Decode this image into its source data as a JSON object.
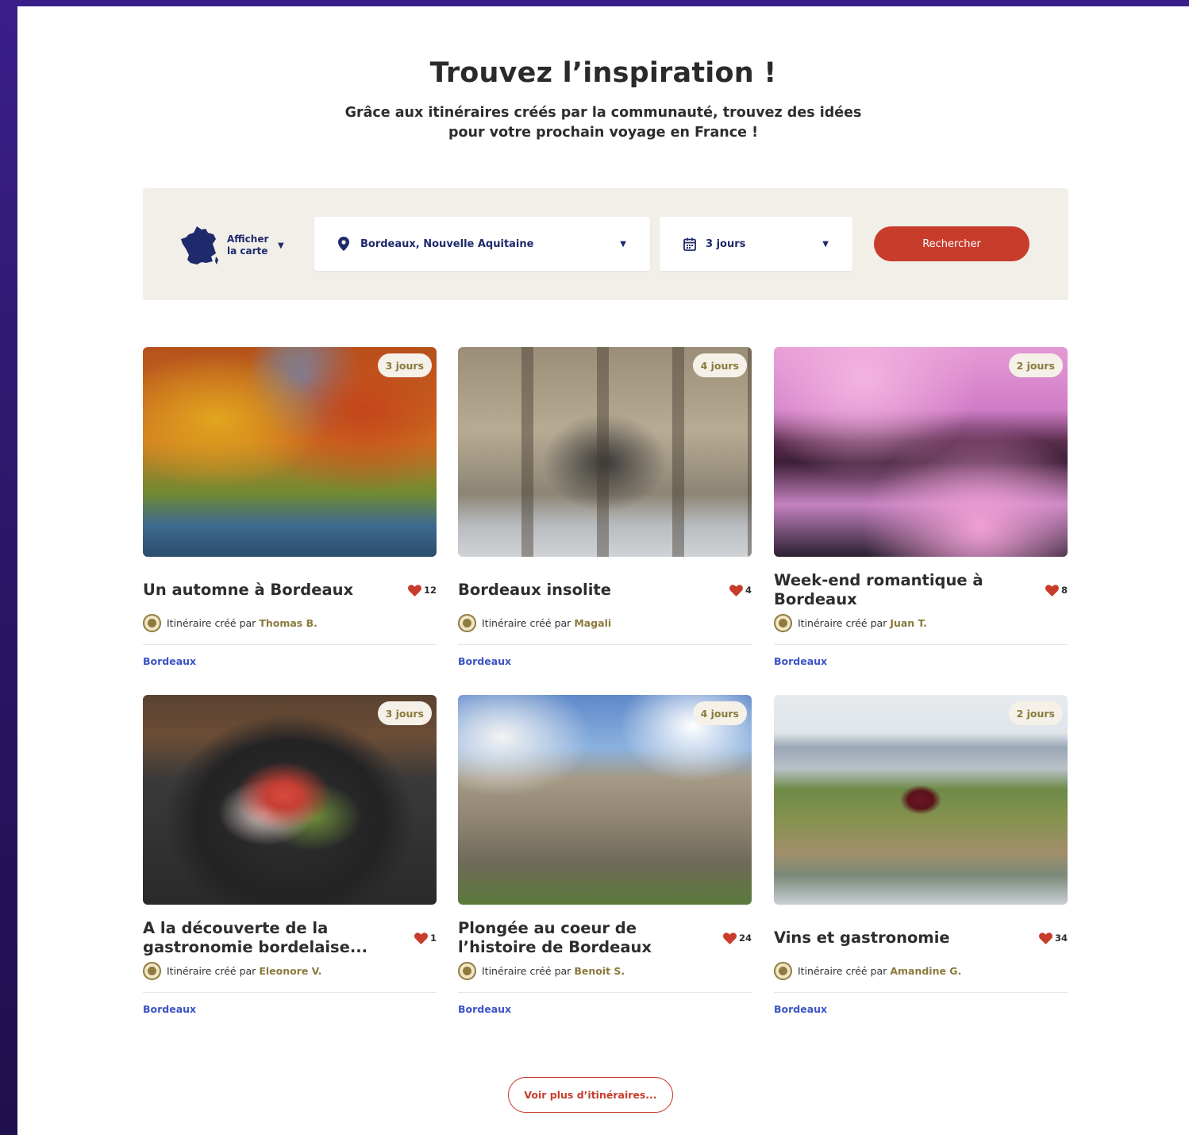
{
  "hero": {
    "title": "Trouvez l’inspiration !",
    "subtitle_line1": "Grâce aux itinéraires créés par la communauté, trouvez des idées",
    "subtitle_line2": "pour votre prochain voyage en France !"
  },
  "search": {
    "map_toggle_line1": "Afficher",
    "map_toggle_line2": "la carte",
    "location_value": "Bordeaux, Nouvelle Aquitaine",
    "duration_value": "3 jours",
    "button_label": "Rechercher"
  },
  "author_prefix": "Itinéraire créé par",
  "cards": [
    {
      "badge": "3 jours",
      "title": "Un automne à Bordeaux",
      "likes": "12",
      "author": "Thomas B.",
      "tag": "Bordeaux"
    },
    {
      "badge": "4 jours",
      "title": "Bordeaux insolite",
      "likes": "4",
      "author": "Magali",
      "tag": "Bordeaux"
    },
    {
      "badge": "2 jours",
      "title": "Week-end romantique à Bordeaux",
      "likes": "8",
      "author": "Juan T.",
      "tag": "Bordeaux"
    },
    {
      "badge": "3 jours",
      "title": "A la découverte de la gastronomie bordelaise...",
      "likes": "1",
      "author": "Eleonore V.",
      "tag": "Bordeaux"
    },
    {
      "badge": "4 jours",
      "title": "Plongée au coeur de l’histoire de Bordeaux",
      "likes": "24",
      "author": "Benoit S.",
      "tag": "Bordeaux"
    },
    {
      "badge": "2 jours",
      "title": "Vins et gastronomie",
      "likes": "34",
      "author": "Amandine G.",
      "tag": "Bordeaux"
    }
  ],
  "more_button": "Voir plus d’itinéraires...",
  "colors": {
    "accent": "#c83c2c",
    "navy": "#1e2a6b",
    "tag_blue": "#3b52c4",
    "author_gold": "#8a7a3c",
    "panel_bg": "#f2efe9"
  }
}
